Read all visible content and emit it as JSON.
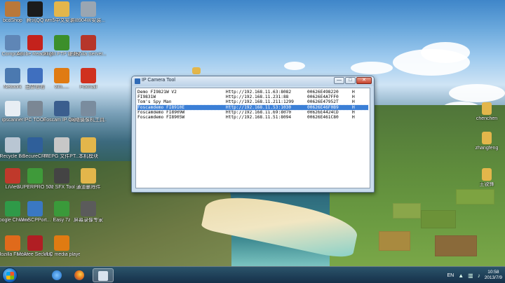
{
  "desktop": {
    "icons": [
      {
        "label": "bcdShop",
        "icon": "shop-icon",
        "color": "#b9783a"
      },
      {
        "label": "腾讯QQ",
        "icon": "qq-penguin-icon",
        "color": "#1b1b1b"
      },
      {
        "label": "wm5中文安装...",
        "icon": "folder-icon",
        "color": "#e3b64b"
      },
      {
        "label": "FI8904W安装...",
        "icon": "document-icon",
        "color": "#9aa6b2"
      },
      {
        "label": "Computer",
        "icon": "computer-icon",
        "color": "#5f86b6"
      },
      {
        "label": "Adobe Reader XI",
        "icon": "adobe-reader-icon",
        "color": "#c4221c"
      },
      {
        "label": "Xlight FTP 服务器",
        "icon": "xlight-ftp-icon",
        "color": "#3c8f2b"
      },
      {
        "label": "FileZilla Server...",
        "icon": "filezilla-icon",
        "color": "#b6362a"
      },
      {
        "label": "Network",
        "icon": "network-icon",
        "color": "#4b79b0"
      },
      {
        "label": "迅雷看看",
        "icon": "xunlei-player-icon",
        "color": "#3f6fbf"
      },
      {
        "label": "vlm.....",
        "icon": "vlc-cone-icon",
        "color": "#e07b12"
      },
      {
        "label": "Foxmail",
        "icon": "foxmail-icon",
        "color": "#d0311f"
      },
      {
        "label": "ipscanner",
        "icon": "document-icon",
        "color": "#e8eef4"
      },
      {
        "label": "IPC TOOL",
        "icon": "ipc-tool-icon",
        "color": "#7b8794"
      },
      {
        "label": "Foscam IP Camera...",
        "icon": "foscam-icon",
        "color": "#3b5e8e"
      },
      {
        "label": "网络摄像机工具...",
        "icon": "camera-tool-icon",
        "color": "#7a8c9e"
      },
      {
        "label": "Recycle Bin",
        "icon": "recycle-bin-icon",
        "color": "#b9c6d3"
      },
      {
        "label": "SecureCRT",
        "icon": "securecrt-icon",
        "color": "#2f5f9a"
      },
      {
        "label": "MEPG 文件PT...",
        "icon": "mpeg-file-icon",
        "color": "#c7c7c7"
      },
      {
        "label": "本机模块",
        "icon": "folder-icon",
        "color": "#e3b64b"
      },
      {
        "label": "LiView",
        "icon": "liview-icon",
        "color": "#c0392b"
      },
      {
        "label": "SUPERPRO 5000E",
        "icon": "superpro-icon",
        "color": "#3f9a3a"
      },
      {
        "label": "7z SFX Tool",
        "icon": "7zip-icon",
        "color": "#444444"
      },
      {
        "label": "通道删除件",
        "icon": "folder-icon",
        "color": "#e3b64b"
      },
      {
        "label": "Google Chrome",
        "icon": "chrome-icon",
        "color": "#2f9a48"
      },
      {
        "label": "WinSCPPort...",
        "icon": "winscp-icon",
        "color": "#3a78c2"
      },
      {
        "label": "Easy 7z",
        "icon": "easy7z-icon",
        "color": "#3a9a3a"
      },
      {
        "label": "屏幕录像专家",
        "icon": "screen-recorder-icon",
        "color": "#5b5b5b"
      },
      {
        "label": "Mozilla Firefox",
        "icon": "firefox-icon",
        "color": "#e06a1b"
      },
      {
        "label": "McAfee Security Sc...",
        "icon": "mcafee-icon",
        "color": "#b01e23"
      },
      {
        "label": "VLC media player",
        "icon": "vlc-cone-icon",
        "color": "#e07b12"
      }
    ],
    "right_icons": [
      {
        "label": "chenchen",
        "icon": "folder-icon",
        "color": "#e3b64b"
      },
      {
        "label": "zhangfeng",
        "icon": "folder-icon",
        "color": "#e3b64b"
      },
      {
        "label": "王锐锋",
        "icon": "folder-icon",
        "color": "#e3b64b"
      }
    ]
  },
  "window": {
    "title": "IP Camera Tool",
    "minimize": "—",
    "maximize": "□",
    "close": "✕",
    "rows": [
      {
        "name": "Demo FI9821W V2",
        "url": "Http://192.168.11.63:8082",
        "mac": "00626E498220",
        "flag": "H",
        "selected": false
      },
      {
        "name": "FI9831W",
        "url": "Http://192.168.11.231:88",
        "mac": "00626E4A7FF0",
        "flag": "H",
        "selected": false
      },
      {
        "name": "Tom's Spy Man",
        "url": "Http://192.168.11.211:1299",
        "mac": "00626E47952T",
        "flag": "H",
        "selected": false
      },
      {
        "name": "Foscamdemo FI8910E",
        "url": "Http://192.168.11.53:1030",
        "mac": "00626E46F0B9",
        "flag": "H",
        "selected": true
      },
      {
        "name": "Foscamdemo FI8909W",
        "url": "Http://192.168.11.69:8070",
        "mac": "00626E4424CD",
        "flag": "H",
        "selected": false
      },
      {
        "name": "Foscamdemo FI8905W",
        "url": "Http://192.168.11.51:8094",
        "mac": "00626E461C80",
        "flag": "H",
        "selected": false
      }
    ]
  },
  "taskbar": {
    "buttons": [
      {
        "icon": "ie-icon",
        "color": "#2f88d8"
      },
      {
        "icon": "firefox-icon",
        "color": "#e06a1b"
      },
      {
        "icon": "ip-camera-tool-icon",
        "color": "#d8e3ee"
      }
    ],
    "language": "EN",
    "time": "10:58",
    "date": "2013/7/9"
  }
}
